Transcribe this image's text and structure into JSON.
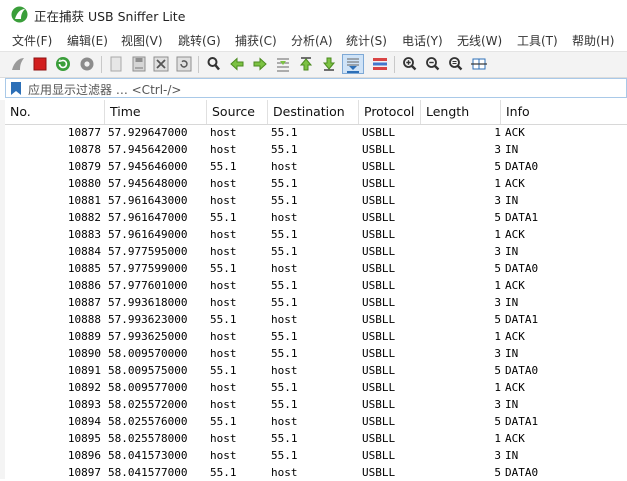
{
  "window": {
    "title": "正在捕获 USB Sniffer Lite"
  },
  "menu": [
    "文件(F)",
    "编辑(E)",
    "视图(V)",
    "跳转(G)",
    "捕获(C)",
    "分析(A)",
    "统计(S)",
    "电话(Y)",
    "无线(W)",
    "工具(T)",
    "帮助(H)"
  ],
  "filter": {
    "placeholder": "应用显示过滤器 … <Ctrl-/>"
  },
  "columns": [
    "No.",
    "Time",
    "Source",
    "Destination",
    "Protocol",
    "Length",
    "Info"
  ],
  "packets": [
    {
      "no": "10877",
      "time": "57.929647000",
      "src": "host",
      "dst": "55.1",
      "proto": "USBLL",
      "len": "1",
      "info": "ACK"
    },
    {
      "no": "10878",
      "time": "57.945642000",
      "src": "host",
      "dst": "55.1",
      "proto": "USBLL",
      "len": "3",
      "info": "IN"
    },
    {
      "no": "10879",
      "time": "57.945646000",
      "src": "55.1",
      "dst": "host",
      "proto": "USBLL",
      "len": "5",
      "info": "DATA0"
    },
    {
      "no": "10880",
      "time": "57.945648000",
      "src": "host",
      "dst": "55.1",
      "proto": "USBLL",
      "len": "1",
      "info": "ACK"
    },
    {
      "no": "10881",
      "time": "57.961643000",
      "src": "host",
      "dst": "55.1",
      "proto": "USBLL",
      "len": "3",
      "info": "IN"
    },
    {
      "no": "10882",
      "time": "57.961647000",
      "src": "55.1",
      "dst": "host",
      "proto": "USBLL",
      "len": "5",
      "info": "DATA1"
    },
    {
      "no": "10883",
      "time": "57.961649000",
      "src": "host",
      "dst": "55.1",
      "proto": "USBLL",
      "len": "1",
      "info": "ACK"
    },
    {
      "no": "10884",
      "time": "57.977595000",
      "src": "host",
      "dst": "55.1",
      "proto": "USBLL",
      "len": "3",
      "info": "IN"
    },
    {
      "no": "10885",
      "time": "57.977599000",
      "src": "55.1",
      "dst": "host",
      "proto": "USBLL",
      "len": "5",
      "info": "DATA0"
    },
    {
      "no": "10886",
      "time": "57.977601000",
      "src": "host",
      "dst": "55.1",
      "proto": "USBLL",
      "len": "1",
      "info": "ACK"
    },
    {
      "no": "10887",
      "time": "57.993618000",
      "src": "host",
      "dst": "55.1",
      "proto": "USBLL",
      "len": "3",
      "info": "IN"
    },
    {
      "no": "10888",
      "time": "57.993623000",
      "src": "55.1",
      "dst": "host",
      "proto": "USBLL",
      "len": "5",
      "info": "DATA1"
    },
    {
      "no": "10889",
      "time": "57.993625000",
      "src": "host",
      "dst": "55.1",
      "proto": "USBLL",
      "len": "1",
      "info": "ACK"
    },
    {
      "no": "10890",
      "time": "58.009570000",
      "src": "host",
      "dst": "55.1",
      "proto": "USBLL",
      "len": "3",
      "info": "IN"
    },
    {
      "no": "10891",
      "time": "58.009575000",
      "src": "55.1",
      "dst": "host",
      "proto": "USBLL",
      "len": "5",
      "info": "DATA0"
    },
    {
      "no": "10892",
      "time": "58.009577000",
      "src": "host",
      "dst": "55.1",
      "proto": "USBLL",
      "len": "1",
      "info": "ACK"
    },
    {
      "no": "10893",
      "time": "58.025572000",
      "src": "host",
      "dst": "55.1",
      "proto": "USBLL",
      "len": "3",
      "info": "IN"
    },
    {
      "no": "10894",
      "time": "58.025576000",
      "src": "55.1",
      "dst": "host",
      "proto": "USBLL",
      "len": "5",
      "info": "DATA1"
    },
    {
      "no": "10895",
      "time": "58.025578000",
      "src": "host",
      "dst": "55.1",
      "proto": "USBLL",
      "len": "1",
      "info": "ACK"
    },
    {
      "no": "10896",
      "time": "58.041573000",
      "src": "host",
      "dst": "55.1",
      "proto": "USBLL",
      "len": "3",
      "info": "IN"
    },
    {
      "no": "10897",
      "time": "58.041577000",
      "src": "55.1",
      "dst": "host",
      "proto": "USBLL",
      "len": "5",
      "info": "DATA0"
    }
  ],
  "colors": {
    "accent": "#2c6fb7",
    "stop": "#d21f1f",
    "fin": "#3a9e3a"
  }
}
